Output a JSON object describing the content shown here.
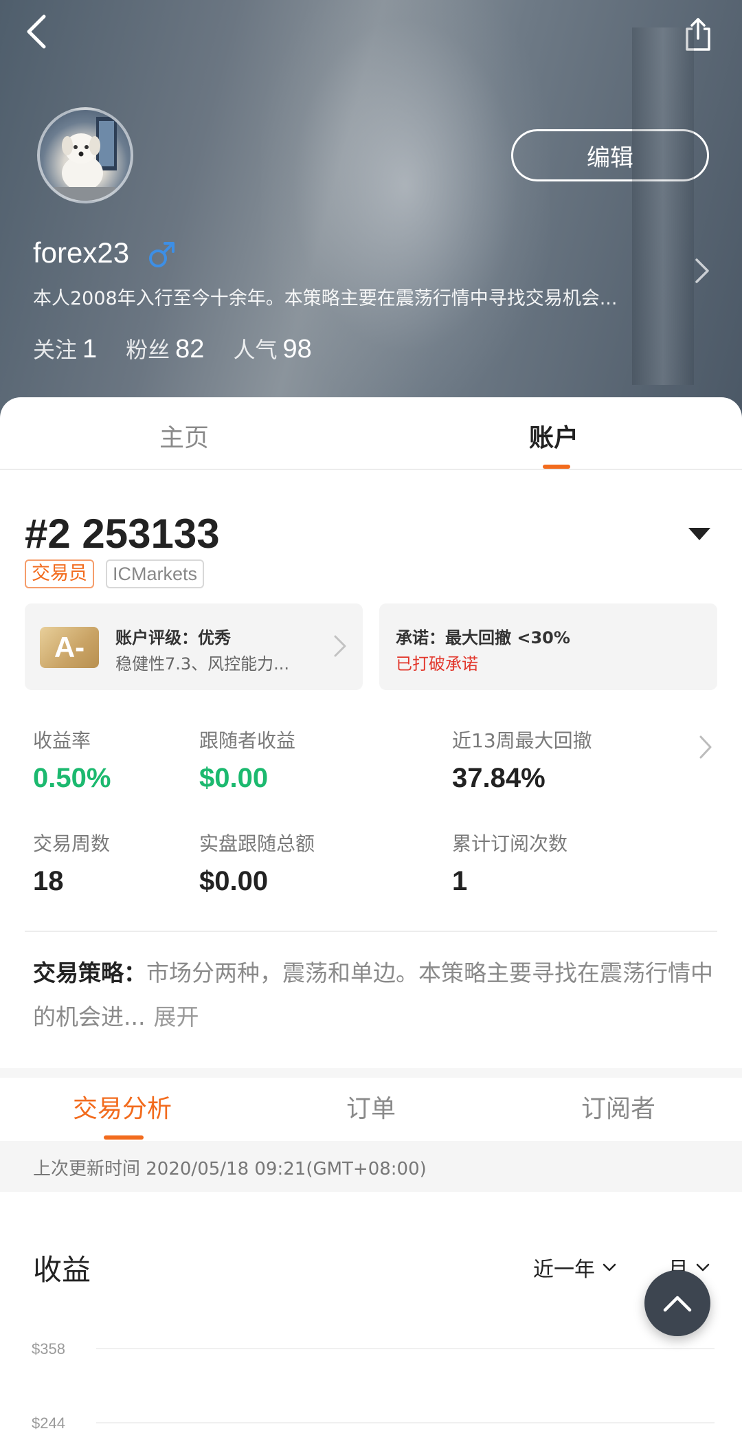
{
  "header": {
    "username": "forex23",
    "gender_symbol": "♂",
    "bio": "本人2008年入行至今十余年。本策略主要在震荡行情中寻找交易机会...",
    "edit_label": "编辑",
    "stats": [
      {
        "label": "关注",
        "value": "1"
      },
      {
        "label": "粉丝",
        "value": "82"
      },
      {
        "label": "人气",
        "value": "98"
      }
    ]
  },
  "tabs": {
    "home": "主页",
    "account": "账户"
  },
  "account": {
    "number": "#2 253133",
    "tag_role": "交易员",
    "tag_broker": "ICMarkets",
    "rating": {
      "grade": "A-",
      "title": "账户评级：优秀",
      "subtitle": "稳健性7.3、风控能力..."
    },
    "promise": {
      "title": "承诺：最大回撤 <30%",
      "status": "已打破承诺"
    },
    "metrics": [
      {
        "label": "收益率",
        "value": "0.50%"
      },
      {
        "label": "跟随者收益",
        "value": "$0.00"
      },
      {
        "label": "近13周最大回撤",
        "value": "37.84%"
      },
      {
        "label": "交易周数",
        "value": "18"
      },
      {
        "label": "实盘跟随总额",
        "value": "$0.00"
      },
      {
        "label": "累计订阅次数",
        "value": "1"
      }
    ],
    "strategy": {
      "label": "交易策略：",
      "text": "市场分两种，震荡和单边。本策略主要寻找在震荡行情中的机会进...",
      "expand": "展开"
    }
  },
  "sub_tabs": {
    "analysis": "交易分析",
    "orders": "订单",
    "subscribers": "订阅者"
  },
  "update_text": "上次更新时间 2020/05/18 09:21(GMT+08:00)",
  "profit": {
    "title": "收益",
    "range_filter": "近一年",
    "period_filter": "月",
    "y_ticks": [
      "$358",
      "$244"
    ]
  },
  "colors": {
    "accent": "#f26b1d",
    "positive": "#1cb96f",
    "alert": "#e2372c"
  }
}
